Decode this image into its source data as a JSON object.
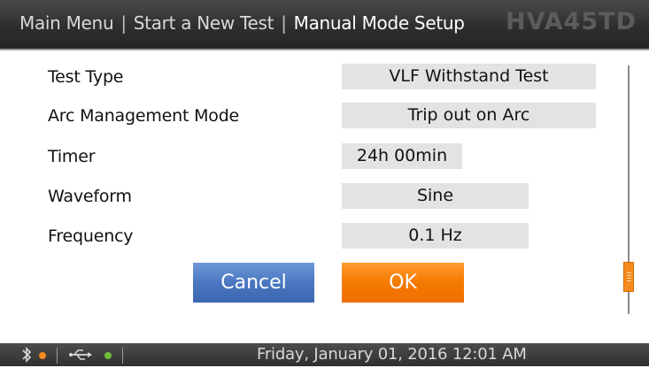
{
  "header": {
    "breadcrumb": [
      "Main Menu",
      "Start a New Test",
      "Manual Mode Setup"
    ],
    "separator": "|",
    "brand": "HVA45TD"
  },
  "settings": [
    {
      "label": "Test Type",
      "value": "VLF Withstand Test"
    },
    {
      "label": "Arc Management Mode",
      "value": "Trip out on Arc"
    },
    {
      "label": "Timer",
      "value": "24h 00min"
    },
    {
      "label": "Waveform",
      "value": "Sine"
    },
    {
      "label": "Frequency",
      "value": "0.1 Hz"
    }
  ],
  "buttons": {
    "cancel": "Cancel",
    "ok": "OK"
  },
  "scroll": {
    "position_fraction": 0.85
  },
  "statusbar": {
    "icons": [
      "bluetooth-icon",
      "orange-status-dot",
      "usb-icon",
      "green-status-dot"
    ],
    "separator": "|",
    "datetime": "Friday, January 01, 2016 12:01 AM"
  },
  "colors": {
    "accent_orange": "#f47a00",
    "accent_blue": "#4a77c0",
    "value_bg": "#e3e3e3",
    "header_bg": "#333333"
  }
}
